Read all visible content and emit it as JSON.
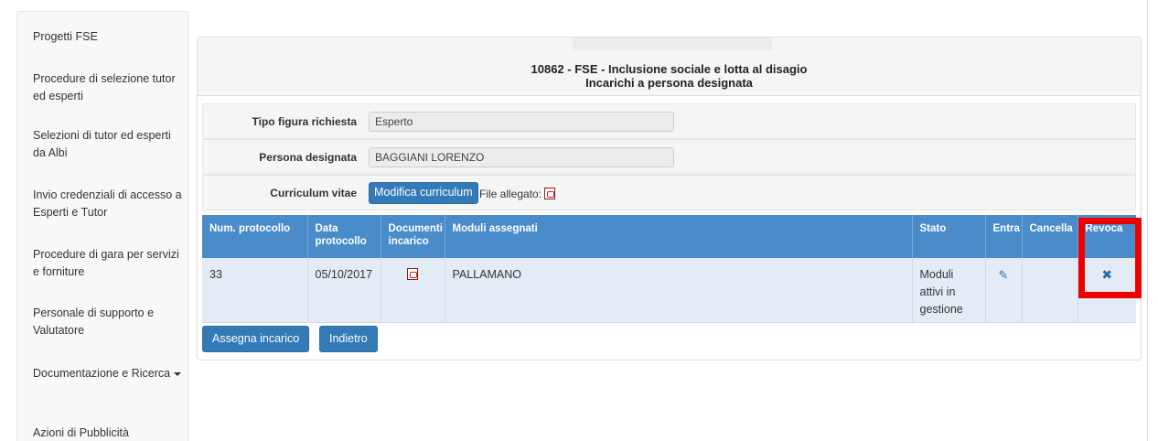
{
  "sidebar": {
    "items": [
      {
        "label": "Progetti FSE"
      },
      {
        "label": "Procedure di selezione tutor ed esperti"
      },
      {
        "label": "Selezioni di tutor ed esperti da Albi"
      },
      {
        "label": "Invio credenziali di accesso a Esperti e Tutor"
      },
      {
        "label": "Procedure di gara per servizi e forniture"
      },
      {
        "label": "Personale di supporto e Valutatore"
      },
      {
        "label": "Documentazione e Ricerca"
      },
      {
        "label": "Azioni di Pubblicità"
      }
    ]
  },
  "panel": {
    "title_line1": "10862 - FSE - Inclusione sociale e lotta al disagio",
    "title_line2": "Incarichi a persona designata"
  },
  "form": {
    "tipo_label": "Tipo figura richiesta",
    "tipo_value": "Esperto",
    "persona_label": "Persona designata",
    "persona_value": "BAGGIANI LORENZO",
    "cv_label": "Curriculum vitae",
    "cv_button": "Modifica curriculum",
    "file_label": "File allegato:"
  },
  "table": {
    "headers": {
      "num_protocollo": "Num. protocollo",
      "data_protocollo": "Data protocollo",
      "documenti_incarico": "Documenti incarico",
      "moduli_assegnati": "Moduli assegnati",
      "stato": "Stato",
      "entra": "Entra",
      "cancella": "Cancella",
      "revoca": "Revoca"
    },
    "rows": [
      {
        "num_protocollo": "33",
        "data_protocollo": "05/10/2017",
        "moduli_assegnati": "PALLAMANO",
        "stato": "Moduli attivi in gestione"
      }
    ]
  },
  "buttons": {
    "assegna": "Assegna incarico",
    "indietro": "Indietro"
  },
  "icons": {
    "pdf": "pdf-icon",
    "edit": "pencil-icon",
    "revoke": "x-icon"
  },
  "colors": {
    "header_blue": "#4a8cc9",
    "button_blue": "#337ab7",
    "row_bg": "#e3ebf5",
    "highlight": "#ee0000"
  }
}
